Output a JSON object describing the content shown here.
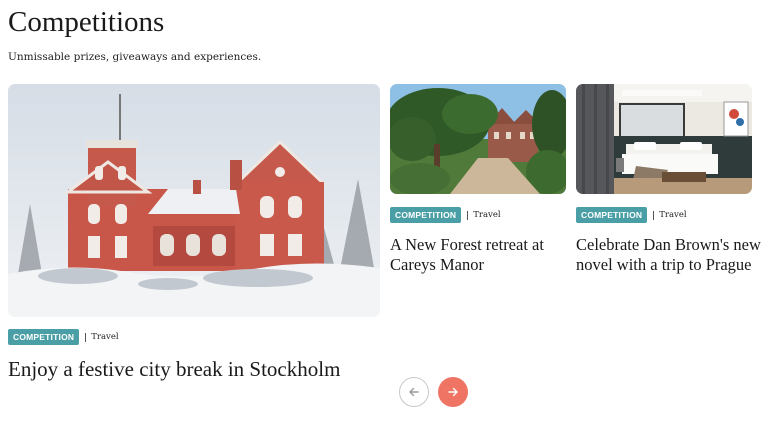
{
  "header": {
    "title": "Competitions",
    "subtitle": "Unmissable prizes, giveaways and experiences."
  },
  "cards": [
    {
      "badge": "COMPETITION",
      "category": "Travel",
      "title": "Enjoy a festive city break in Stockholm",
      "image": "snowy-red-brick-manor"
    },
    {
      "badge": "COMPETITION",
      "category": "Travel",
      "title": "A New Forest retreat at Careys Manor",
      "image": "manor-garden-driveway"
    },
    {
      "badge": "COMPETITION",
      "category": "Travel",
      "title": "Celebrate Dan Brown's new novel with a trip to Prague",
      "image": "hotel-bedroom"
    }
  ],
  "carousel": {
    "prev_icon": "arrow-left-icon",
    "next_icon": "arrow-right-icon"
  },
  "colors": {
    "badge": "#4a9fa6",
    "next_button": "#f07464",
    "text": "#1a1a1a"
  }
}
